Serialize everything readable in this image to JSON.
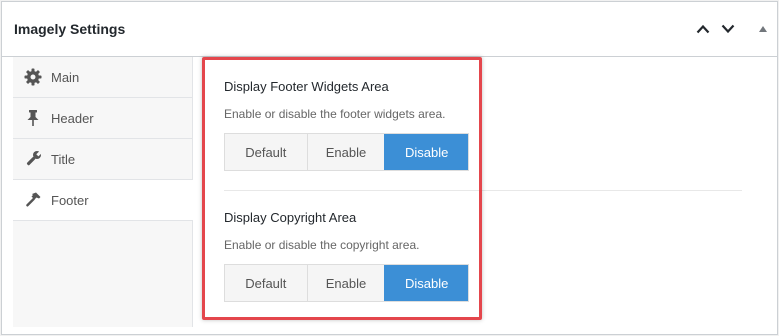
{
  "metabox": {
    "title": "Imagely Settings",
    "controls": {
      "move_up": "chevron-up-icon",
      "move_down": "chevron-down-icon",
      "toggle": "triangle-up-icon"
    }
  },
  "sidebar": {
    "items": [
      {
        "label": "Main",
        "icon": "gear-icon",
        "active": false
      },
      {
        "label": "Header",
        "icon": "pin-icon",
        "active": false
      },
      {
        "label": "Title",
        "icon": "wrench-icon",
        "active": false
      },
      {
        "label": "Footer",
        "icon": "hammer-icon",
        "active": true
      }
    ]
  },
  "fields": [
    {
      "title": "Display Footer Widgets Area",
      "description": "Enable or disable the footer widgets area.",
      "options": [
        "Default",
        "Enable",
        "Disable"
      ],
      "selected": "Disable"
    },
    {
      "title": "Display Copyright Area",
      "description": "Enable or disable the copyright area.",
      "options": [
        "Default",
        "Enable",
        "Disable"
      ],
      "selected": "Disable"
    }
  ],
  "colors": {
    "active_button": "#3c8fd6",
    "highlight_border": "#e4464c"
  }
}
